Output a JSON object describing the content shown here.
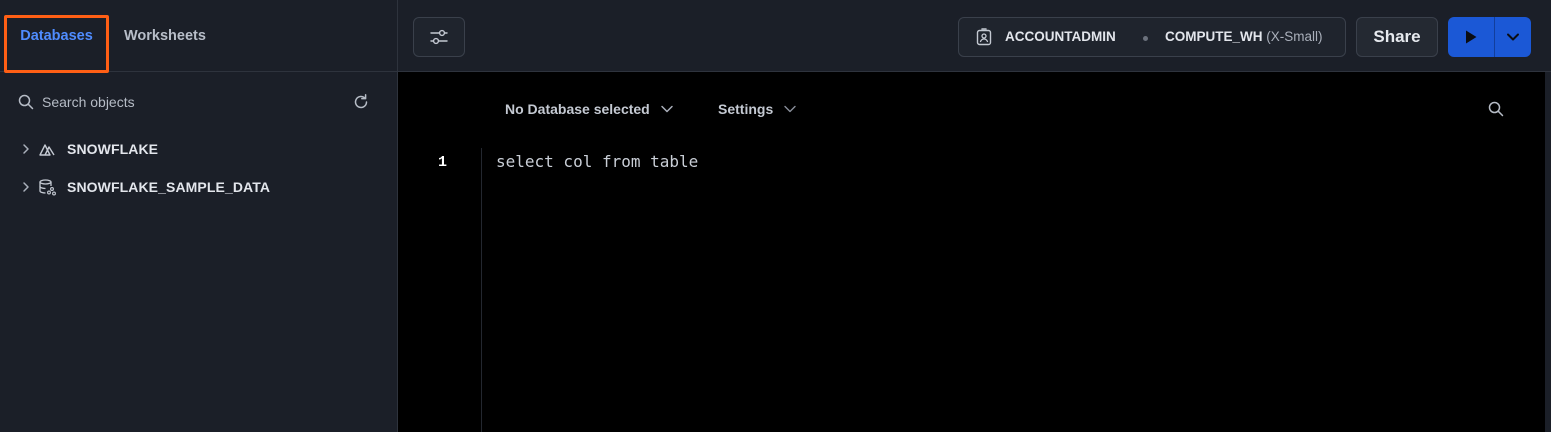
{
  "sidebar": {
    "tabs": [
      {
        "label": "Databases",
        "active": true
      },
      {
        "label": "Worksheets",
        "active": false
      }
    ],
    "search": {
      "placeholder": "Search objects",
      "value": ""
    },
    "tree": [
      {
        "label": "SNOWFLAKE",
        "icon": "snowflake-db-icon",
        "expanded": false
      },
      {
        "label": "SNOWFLAKE_SAMPLE_DATA",
        "icon": "shared-database-icon",
        "expanded": false
      }
    ]
  },
  "header": {
    "role": "ACCOUNTADMIN",
    "warehouse": "COMPUTE_WH",
    "warehouse_size": "(X-Small)",
    "share_label": "Share"
  },
  "editor": {
    "database_dropdown": "No Database selected",
    "settings_dropdown": "Settings",
    "lines": [
      {
        "number": "1",
        "text": "select col from table"
      }
    ]
  },
  "colors": {
    "accent": "#4f8cff",
    "highlight_box": "#ff5f15",
    "run_button": "#1b58d6",
    "editor_bg": "#000000",
    "panel_bg": "#1b1f28"
  }
}
